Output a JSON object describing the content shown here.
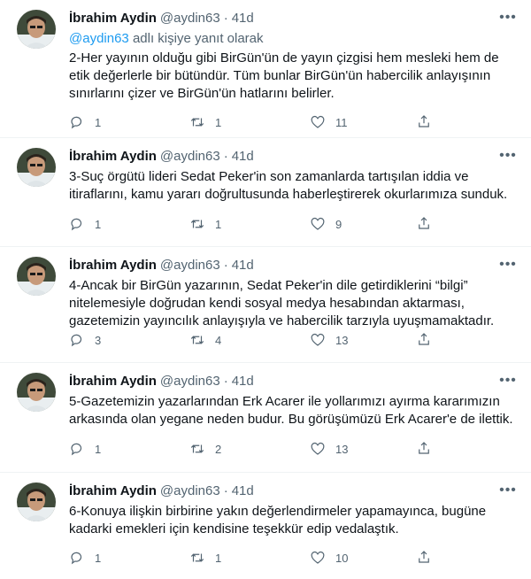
{
  "tweets": [
    {
      "name": "İbrahim Aydin",
      "handle": "@aydin63",
      "dot": "·",
      "time": "41d",
      "reply_prefix": "@aydin63",
      "reply_suffix": " adlı kişiye yanıt olarak",
      "text": "2-Her yayının olduğu gibi BirGün'ün de yayın çizgisi hem mesleki hem de etik değerlerle bir bütündür. Tüm bunlar BirGün'ün habercilik anlayışının sınırlarını çizer ve BirGün'ün hatlarını belirler.",
      "replies": "1",
      "retweets": "1",
      "likes": "11"
    },
    {
      "name": "İbrahim Aydin",
      "handle": "@aydin63",
      "dot": "·",
      "time": "41d",
      "text": "3-Suç örgütü lideri Sedat Peker'in son zamanlarda tartışılan iddia ve itiraflarını, kamu yararı doğrultusunda haberleştirerek okurlarımıza sunduk.",
      "replies": "1",
      "retweets": "1",
      "likes": "9"
    },
    {
      "name": "İbrahim Aydin",
      "handle": "@aydin63",
      "dot": "·",
      "time": "41d",
      "text": "4-Ancak bir BirGün yazarının, Sedat Peker'in dile getirdiklerini “bilgi” nitelemesiyle doğrudan kendi sosyal medya hesabından aktarması, gazetemizin yayıncılık anlayışıyla ve habercilik tarzıyla uyuşmamaktadır.",
      "replies": "3",
      "retweets": "4",
      "likes": "13"
    },
    {
      "name": "İbrahim Aydin",
      "handle": "@aydin63",
      "dot": "·",
      "time": "41d",
      "text": "5-Gazetemizin yazarlarından Erk Acarer ile yollarımızı ayırma kararımızın arkasında olan yegane neden budur. Bu görüşümüzü Erk Acarer'e de ilettik.",
      "replies": "1",
      "retweets": "2",
      "likes": "13"
    },
    {
      "name": "İbrahim Aydin",
      "handle": "@aydin63",
      "dot": "·",
      "time": "41d",
      "text": "6-Konuya ilişkin birbirine yakın değerlendirmeler yapamayınca, bugüne kadarki emekleri için kendisine teşekkür edip vedalaştık.",
      "replies": "1",
      "retweets": "1",
      "likes": "10"
    }
  ],
  "icons": {
    "reply": "reply-icon",
    "retweet": "retweet-icon",
    "like": "like-icon",
    "share": "share-icon",
    "more": "more-icon"
  },
  "colors": {
    "link": "#1d9bf0",
    "secondary_text": "#536471",
    "primary_text": "#0f1419"
  }
}
